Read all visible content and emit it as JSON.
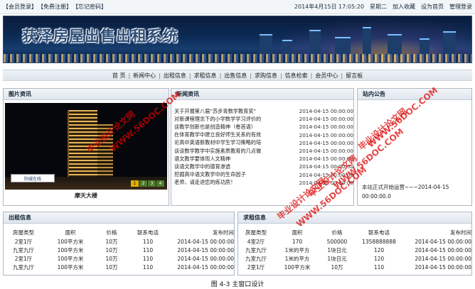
{
  "top_links": [
    "【会员登录】",
    "【免费注册】",
    "【忘记密码】"
  ],
  "top_right": {
    "datetime": "2014年4月15日 17:05:20",
    "weekday": "星期二",
    "actions": [
      "加入收藏",
      "设为首页",
      "管理登录"
    ]
  },
  "banner_title": "获泽房屋出售出租系统",
  "nav": [
    "首 页",
    "新闻中心",
    "出租信息",
    "求租信息",
    "出售信息",
    "求购信息",
    "信息检索",
    "会员中心",
    "留言板"
  ],
  "photo_panel": {
    "title": "图片资讯",
    "caption": "摩天大楼",
    "pager": [
      "1",
      "2",
      "3",
      "4"
    ],
    "logo_text": "阳城在线"
  },
  "news_panel": {
    "title": "新闻资讯",
    "items": [
      {
        "title": "关于开展第八届“苏步青数学教育奖”",
        "date": "2014-04-15 00:00:00"
      },
      {
        "title": "对新课程理念下的小学数学学习评价的",
        "date": "2014-04-15 00:00:00"
      },
      {
        "title": "谈教学创新也是创造精神（卷首语）",
        "date": "2014-04-15 00:00:00"
      },
      {
        "title": "在体育教学中建立良好师生关系的有效",
        "date": "2014-04-15 00:00:00"
      },
      {
        "title": "论高中英语新教材中学生学习策略的培",
        "date": "2014-04-15 00:00:00"
      },
      {
        "title": "谈谈数学教学中实施素质教育的几点做",
        "date": "2014-04-15 00:00:00"
      },
      {
        "title": "语文教学要体现人文精神",
        "date": "2014-04-15 00:00:00"
      },
      {
        "title": "谈语文教学中的德育渗透",
        "date": "2014-04-15 00:00:00"
      },
      {
        "title": "挖掘高中语文教学中的生命因子",
        "date": "2014-04-15 00:00:00"
      },
      {
        "title": "老师，请走进您的练功房！",
        "date": "2014-04-15 00:00:00"
      }
    ]
  },
  "notice_panel": {
    "title": "站内公告",
    "text": "本站正式开始运营~~~2014-04-15 00:00:00.0"
  },
  "rent_panel": {
    "title": "出租信息",
    "headers": [
      "房屋类型",
      "面积",
      "价格",
      "联系电话",
      "发布时间"
    ],
    "rows": [
      [
        "2室1厅",
        "100平方米",
        "10万",
        "110",
        "2014-04-15 00:00:00"
      ],
      [
        "九室九厅",
        "100平方米",
        "10万",
        "110",
        "2014-04-15 00:00:00"
      ],
      [
        "2室1厅",
        "100平方米",
        "10万",
        "110",
        "2014-04-15 00:00:00"
      ],
      [
        "九室九厅",
        "100平方米",
        "10万",
        "110",
        "2014-04-15 00:00:00"
      ]
    ]
  },
  "seek_panel": {
    "title": "求租信息",
    "headers": [
      "房屋类型",
      "面积",
      "价格",
      "联系电话",
      "发布时间"
    ],
    "rows": [
      [
        "4室2厅",
        "170",
        "500000",
        "1358888888",
        "2014-04-15 00:00:00"
      ],
      [
        "九室九厅",
        "1米的平方",
        "1块日元",
        "120",
        "2014-04-15 00:00:00"
      ],
      [
        "九室九厅",
        "1米的平方",
        "1块日元",
        "120",
        "2014-04-15 00:00:00"
      ],
      [
        "2室1厅",
        "100平方米",
        "10万",
        "110",
        "2014-04-15 00:00:00"
      ]
    ]
  },
  "watermarks": [
    "毕业设计论文网",
    "WWW.56DOC.COM",
    "毕业设计论文网",
    "WWW.56DOC.COM",
    "毕业设计论文网",
    "WWW.56DOC.COM",
    "毕业设计论文网",
    "WWW.56DOC.COM"
  ],
  "footer_caption": "图 4-3  主窗口设计"
}
